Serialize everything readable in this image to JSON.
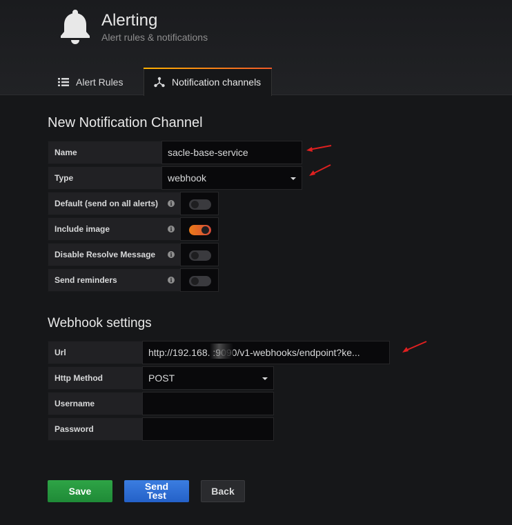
{
  "header": {
    "title": "Alerting",
    "subtitle": "Alert rules & notifications",
    "icon": "bell-icon"
  },
  "tabs": [
    {
      "label": "Alert Rules",
      "icon": "list-icon",
      "active": false
    },
    {
      "label": "Notification channels",
      "icon": "share-nodes-icon",
      "active": true
    }
  ],
  "channel": {
    "heading": "New Notification Channel",
    "name_label": "Name",
    "name_value": "sacle-base-service",
    "type_label": "Type",
    "type_value": "webhook",
    "toggles": [
      {
        "label": "Default (send on all alerts)",
        "on": false
      },
      {
        "label": "Include image",
        "on": true
      },
      {
        "label": "Disable Resolve Message",
        "on": false
      },
      {
        "label": "Send reminders",
        "on": false
      }
    ],
    "info_glyph": "i"
  },
  "webhook": {
    "heading": "Webhook settings",
    "url_label": "Url",
    "url_value": "http://192.168.       :9090/v1-webhooks/endpoint?ke...",
    "method_label": "Http Method",
    "method_value": "POST",
    "username_label": "Username",
    "username_value": "",
    "password_label": "Password",
    "password_value": ""
  },
  "buttons": {
    "save": "Save",
    "send_test": "Send Test",
    "back": "Back"
  },
  "colors": {
    "accent_orange": "#eb7b18",
    "annotation_red": "#e02020",
    "save_green": "#2ea446",
    "test_blue": "#3b7de0"
  }
}
